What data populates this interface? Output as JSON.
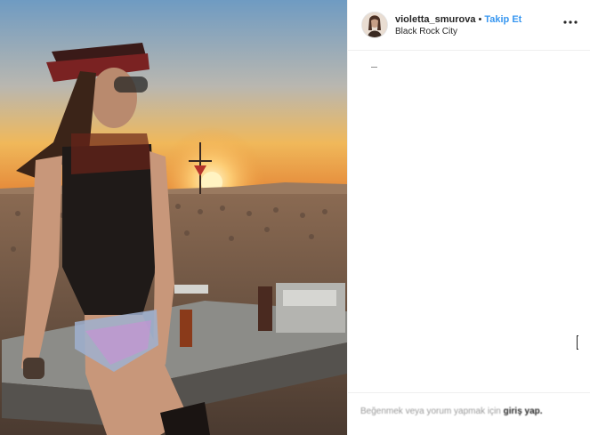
{
  "post": {
    "username": "violetta_smurova",
    "separator": "•",
    "follow_label": "Takip Et",
    "location": "Black Rock City",
    "more_icon": "more-options-icon"
  },
  "footer": {
    "prompt": "Beğenmek veya yorum yapmak için",
    "login_label": "giriş yap."
  },
  "photo": {
    "icon": "post-photo",
    "colors": {
      "sky_top": "#6f9bc2",
      "horizon": "#f0b85a",
      "sun": "#fff3c2",
      "crowd": "#6b5546"
    }
  }
}
